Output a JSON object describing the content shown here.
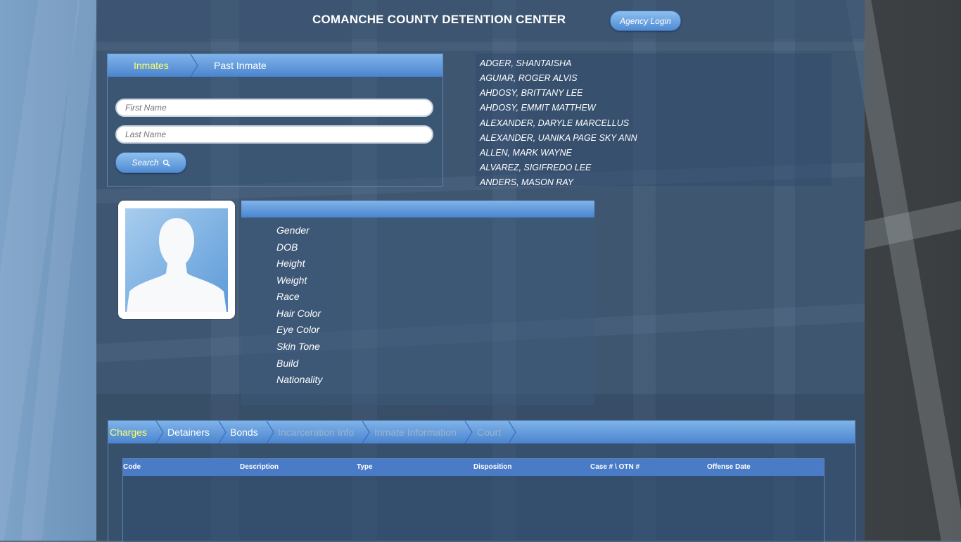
{
  "header": {
    "title": "COMANCHE COUNTY DETENTION CENTER",
    "agency_login": "Agency Login"
  },
  "search_tabs": {
    "inmates": "Inmates",
    "past_inmate": "Past Inmate"
  },
  "search": {
    "first_name_placeholder": "First Name",
    "last_name_placeholder": "Last Name",
    "button": "Search"
  },
  "inmates": [
    "ADGER, SHANTAISHA",
    "AGUIAR, ROGER ALVIS",
    "AHDOSY, BRITTANY LEE",
    "AHDOSY, EMMIT MATTHEW",
    "ALEXANDER, DARYLE MARCELLUS",
    "ALEXANDER, UANIKA PAGE SKY ANN",
    "ALLEN, MARK WAYNE",
    "ALVAREZ, SIGIFREDO LEE",
    "ANDERS, MASON RAY"
  ],
  "details": {
    "labels": [
      "Gender",
      "DOB",
      "Height",
      "Weight",
      "Race",
      "Hair Color",
      "Eye Color",
      "Skin Tone",
      "Build",
      "Nationality"
    ]
  },
  "charge_tabs": {
    "charges": "Charges",
    "detainers": "Detainers",
    "bonds": "Bonds",
    "incarceration": "Incarceration Info",
    "inmate_info": "Inmate Information",
    "court": "Court"
  },
  "charges_table": {
    "columns": [
      "Code",
      "Description",
      "Type",
      "Disposition",
      "Case # \\ OTN #",
      "Offense Date"
    ]
  },
  "colors": {
    "accent": "#4b85cf",
    "active_tab": "#ffff66"
  }
}
